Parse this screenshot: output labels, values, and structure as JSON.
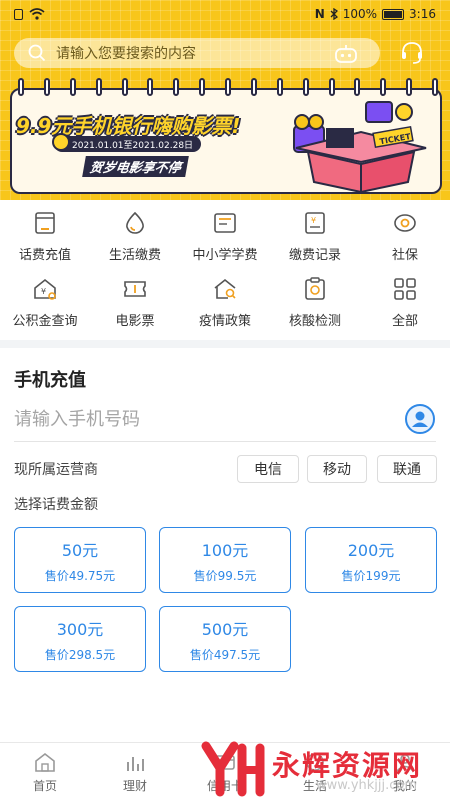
{
  "status_bar": {
    "battery": "100%",
    "time": "3:16"
  },
  "search": {
    "placeholder": "请输入您要搜索的内容",
    "icons": [
      "search-icon",
      "robot-icon",
      "headset-icon"
    ]
  },
  "banner": {
    "title": "9.9元手机银行嗨购影票!",
    "date_range": "2021.01.01至2021.02.28日",
    "subtitle": "贺岁电影享不停",
    "ticket_text": "TICKET"
  },
  "services": {
    "row1": [
      {
        "label": "话费充值",
        "icon": "phone-bill-icon"
      },
      {
        "label": "生活缴费",
        "icon": "water-drop-icon"
      },
      {
        "label": "中小学学费",
        "icon": "book-icon"
      },
      {
        "label": "缴费记录",
        "icon": "receipt-icon"
      },
      {
        "label": "社保",
        "icon": "social-security-icon"
      }
    ],
    "row2": [
      {
        "label": "公积金查询",
        "icon": "house-fund-icon"
      },
      {
        "label": "电影票",
        "icon": "ticket-icon"
      },
      {
        "label": "疫情政策",
        "icon": "house-search-icon"
      },
      {
        "label": "核酸检测",
        "icon": "clipboard-icon"
      },
      {
        "label": "全部",
        "icon": "grid-icon"
      }
    ]
  },
  "recharge": {
    "title": "手机充值",
    "phone_placeholder": "请输入手机号码",
    "carrier_label": "现所属运营商",
    "carriers": [
      "电信",
      "移动",
      "联通"
    ],
    "amount_label": "选择话费金额",
    "amounts": [
      {
        "face": "50元",
        "price": "售价49.75元"
      },
      {
        "face": "100元",
        "price": "售价99.5元"
      },
      {
        "face": "200元",
        "price": "售价199元"
      },
      {
        "face": "300元",
        "price": "售价298.5元"
      },
      {
        "face": "500元",
        "price": "售价497.5元"
      }
    ]
  },
  "bottom_nav": [
    {
      "label": "首页",
      "icon": "home-icon"
    },
    {
      "label": "理财",
      "icon": "chart-icon"
    },
    {
      "label": "信用卡",
      "icon": "credit-card-icon"
    },
    {
      "label": "生活",
      "icon": "life-icon"
    },
    {
      "label": "我的",
      "icon": "user-icon"
    }
  ],
  "watermark": {
    "text": "永辉资源网",
    "url": "www.yhkjjj.com"
  },
  "colors": {
    "brand_yellow": "#f8c61b",
    "accent_blue": "#2f88e6",
    "banner_dark": "#2a2a44",
    "gift_pink": "#f06a80",
    "watermark_red": "#e52d3a"
  }
}
